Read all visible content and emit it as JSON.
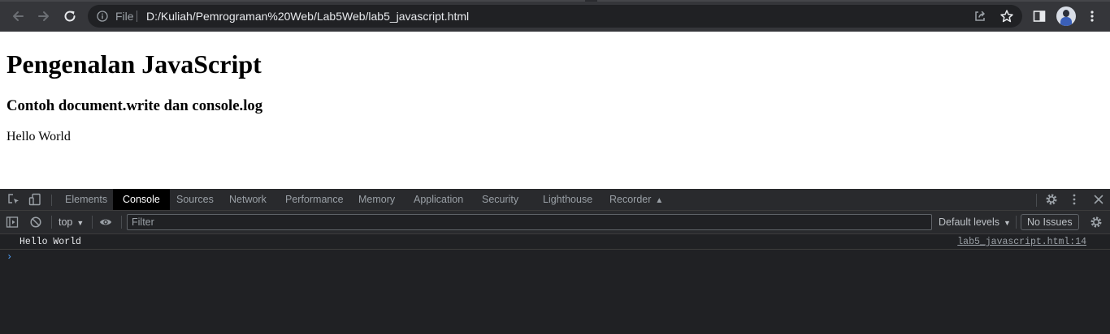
{
  "browser": {
    "url_scheme": "File",
    "url": "D:/Kuliah/Pemrograman%20Web/Lab5Web/lab5_javascript.html",
    "icons": {
      "back": "arrow-left-icon",
      "forward": "arrow-right-icon",
      "reload": "reload-icon",
      "info": "info-icon",
      "share": "share-icon",
      "bookmark": "star-icon",
      "side_panel": "side-panel-icon",
      "profile": "avatar",
      "menu": "kebab-menu-icon"
    }
  },
  "page": {
    "heading": "Pengenalan JavaScript",
    "subheading": "Contoh document.write dan console.log",
    "text": "Hello World"
  },
  "devtools": {
    "tabs": [
      {
        "label": "Elements"
      },
      {
        "label": "Console",
        "active": true
      },
      {
        "label": "Sources"
      },
      {
        "label": "Network"
      },
      {
        "label": "Performance"
      },
      {
        "label": "Memory"
      },
      {
        "label": "Application"
      },
      {
        "label": "Security"
      },
      {
        "label": "Lighthouse"
      },
      {
        "label": "Recorder"
      }
    ],
    "console": {
      "context": "top",
      "filter_placeholder": "Filter",
      "levels": "Default levels",
      "issues": "No Issues",
      "messages": [
        {
          "text": "Hello World",
          "source": "lab5_javascript.html:14"
        }
      ],
      "prompt": "›"
    }
  },
  "colors": {
    "toolbar_bg": "#35363a",
    "omnibox_bg": "#202124",
    "devtools_bg": "#202124",
    "devtools_bar_bg": "#292a2d",
    "active_tab_bg": "#000000",
    "prompt_color": "#4ea3ff"
  }
}
